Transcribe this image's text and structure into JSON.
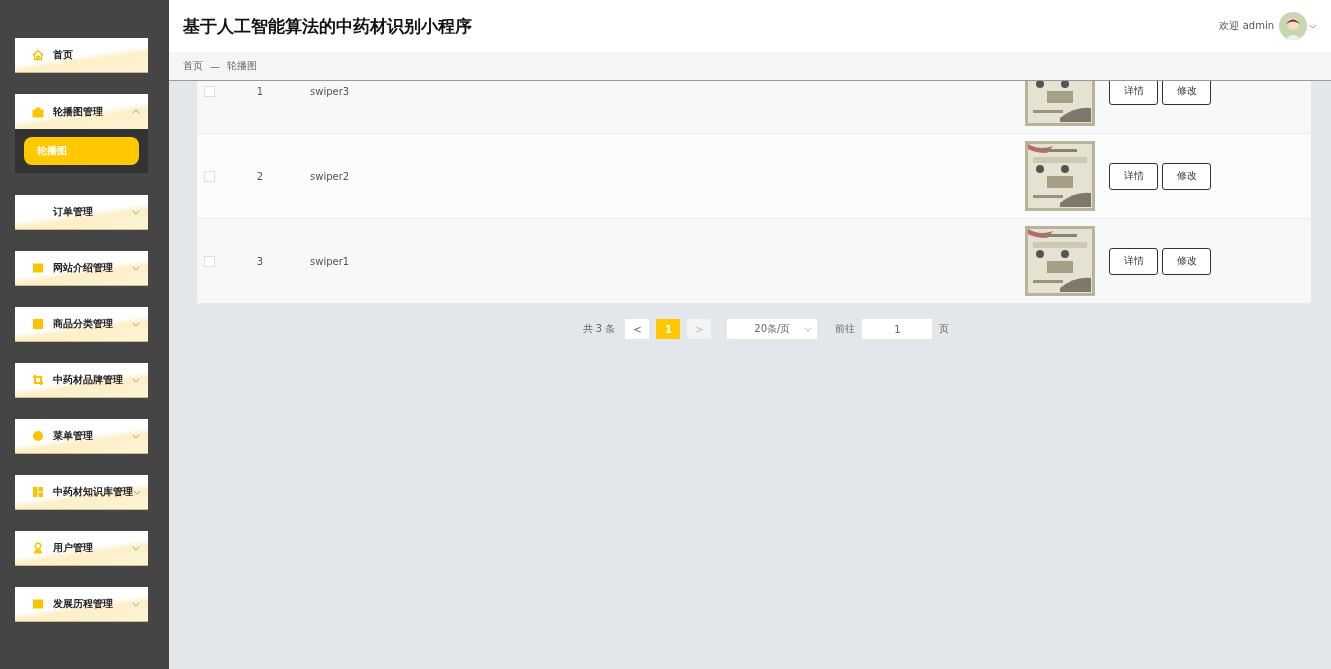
{
  "header": {
    "title": "基于人工智能算法的中药材识别小程序",
    "greeting": "欢迎 admin"
  },
  "sidebar": {
    "items": [
      {
        "label": "首页",
        "kind": "link"
      },
      {
        "label": "轮播图管理",
        "kind": "group",
        "expanded": true,
        "children": [
          {
            "label": "轮播图",
            "selected": true
          }
        ]
      },
      {
        "label": "订单管理",
        "kind": "group",
        "expanded": false
      },
      {
        "label": "网站介绍管理",
        "kind": "group",
        "expanded": false
      },
      {
        "label": "商品分类管理",
        "kind": "group",
        "expanded": false
      },
      {
        "label": "中药材品牌管理",
        "kind": "group",
        "expanded": false
      },
      {
        "label": "菜单管理",
        "kind": "group",
        "expanded": false
      },
      {
        "label": "中药材知识库管理",
        "kind": "group",
        "expanded": false
      },
      {
        "label": "用户管理",
        "kind": "group",
        "expanded": false
      },
      {
        "label": "发展历程管理",
        "kind": "group",
        "expanded": false
      }
    ]
  },
  "breadcrumb": [
    "首页",
    "—",
    "轮播图"
  ],
  "table": {
    "rows": [
      {
        "checked": false,
        "index": "1",
        "name": "swiper3",
        "image": {
          "kind": "picture"
        },
        "actions": [
          "详情",
          "修改"
        ]
      },
      {
        "checked": false,
        "index": "2",
        "name": "swiper2",
        "image": {
          "kind": "picture"
        },
        "actions": [
          "详情",
          "修改"
        ]
      },
      {
        "checked": false,
        "index": "3",
        "name": "swiper1",
        "image": {
          "kind": "picture"
        },
        "actions": [
          "详情",
          "修改"
        ]
      }
    ]
  },
  "pagination": {
    "total": "共 3 条",
    "prev": "<",
    "pages": [
      {
        "label": "1",
        "selected": true
      }
    ],
    "next": ">",
    "page_size": "20条/页",
    "goto_label": "前往",
    "goto_value": "1",
    "goto_suffix": "页"
  }
}
